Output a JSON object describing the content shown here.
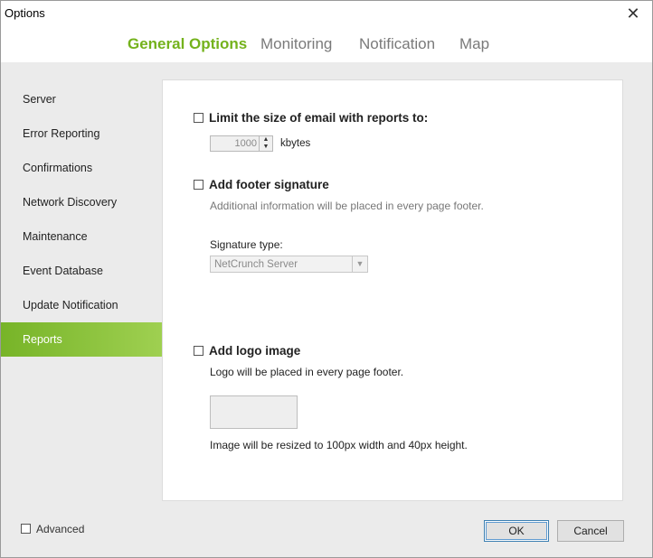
{
  "window": {
    "title": "Options",
    "close_glyph": "✕"
  },
  "tabs": [
    {
      "label": "General Options",
      "active": true
    },
    {
      "label": "Monitoring",
      "active": false
    },
    {
      "label": "Notification",
      "active": false
    },
    {
      "label": "Map",
      "active": false
    }
  ],
  "sidebar": {
    "items": [
      {
        "label": "Server"
      },
      {
        "label": "Error Reporting"
      },
      {
        "label": "Confirmations"
      },
      {
        "label": "Network Discovery"
      },
      {
        "label": "Maintenance"
      },
      {
        "label": "Event Database"
      },
      {
        "label": "Update Notification"
      },
      {
        "label": "Reports",
        "active": true
      }
    ]
  },
  "reports": {
    "limit_size": {
      "label": "Limit the size of email with reports to:",
      "checked": false,
      "value": "1000",
      "unit": "kbytes"
    },
    "footer_signature": {
      "label": "Add footer signature",
      "checked": false,
      "description": "Additional information will be placed in every page footer.",
      "type_label": "Signature type:",
      "type_value": "NetCrunch Server"
    },
    "logo_image": {
      "label": "Add logo image",
      "checked": false,
      "description": "Logo will be placed in every page footer.",
      "resize_note": "Image will be resized to 100px width and 40px height."
    }
  },
  "footer": {
    "advanced_label": "Advanced",
    "advanced_checked": false,
    "ok_label": "OK",
    "cancel_label": "Cancel"
  },
  "colors": {
    "accent": "#74b21c",
    "active_item_start": "#77b428",
    "active_item_end": "#9fd051"
  }
}
